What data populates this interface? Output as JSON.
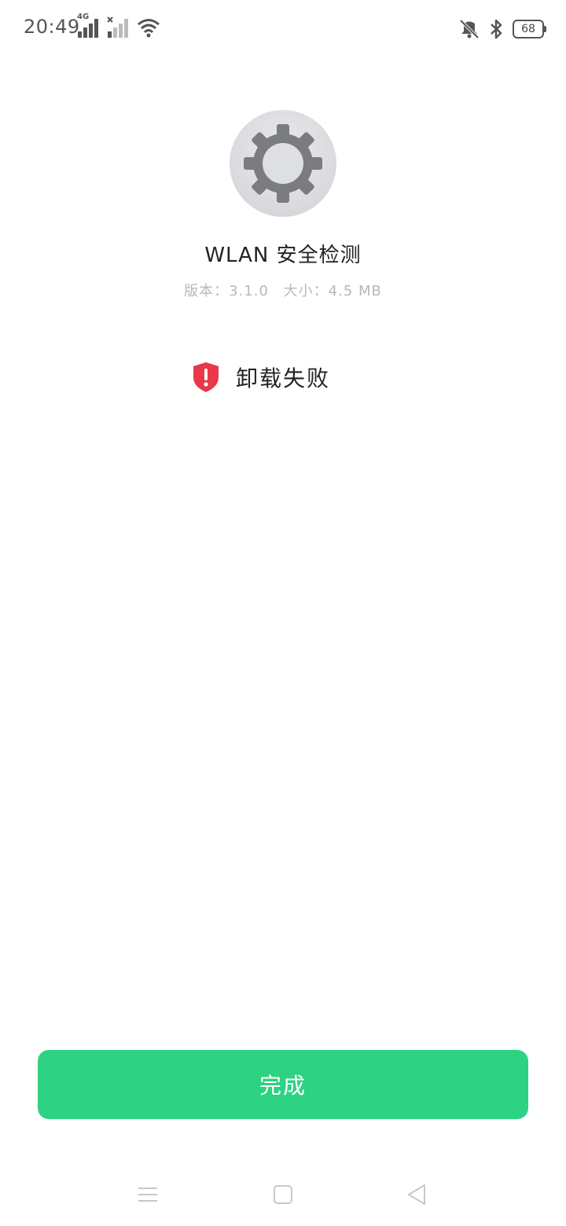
{
  "status_bar": {
    "time": "20:49",
    "network_label": "4G",
    "battery_level": "68",
    "icons": [
      "signal-4g-icon",
      "signal-no-sim-icon",
      "wifi-icon",
      "vibrate-off-icon",
      "bluetooth-icon",
      "battery-icon"
    ]
  },
  "app": {
    "name": "WLAN 安全检测",
    "version_label": "版本：3.1.0",
    "size_label": "大小：4.5 MB",
    "icon": "settings-gear-icon"
  },
  "result": {
    "text": "卸载失败",
    "icon": "shield-warning-icon",
    "color": "#e8384a"
  },
  "actions": {
    "done_label": "完成",
    "accent_color": "#2dd283"
  },
  "nav_bar": {
    "icons": [
      "menu-icon",
      "home-square-icon",
      "back-triangle-icon"
    ]
  }
}
